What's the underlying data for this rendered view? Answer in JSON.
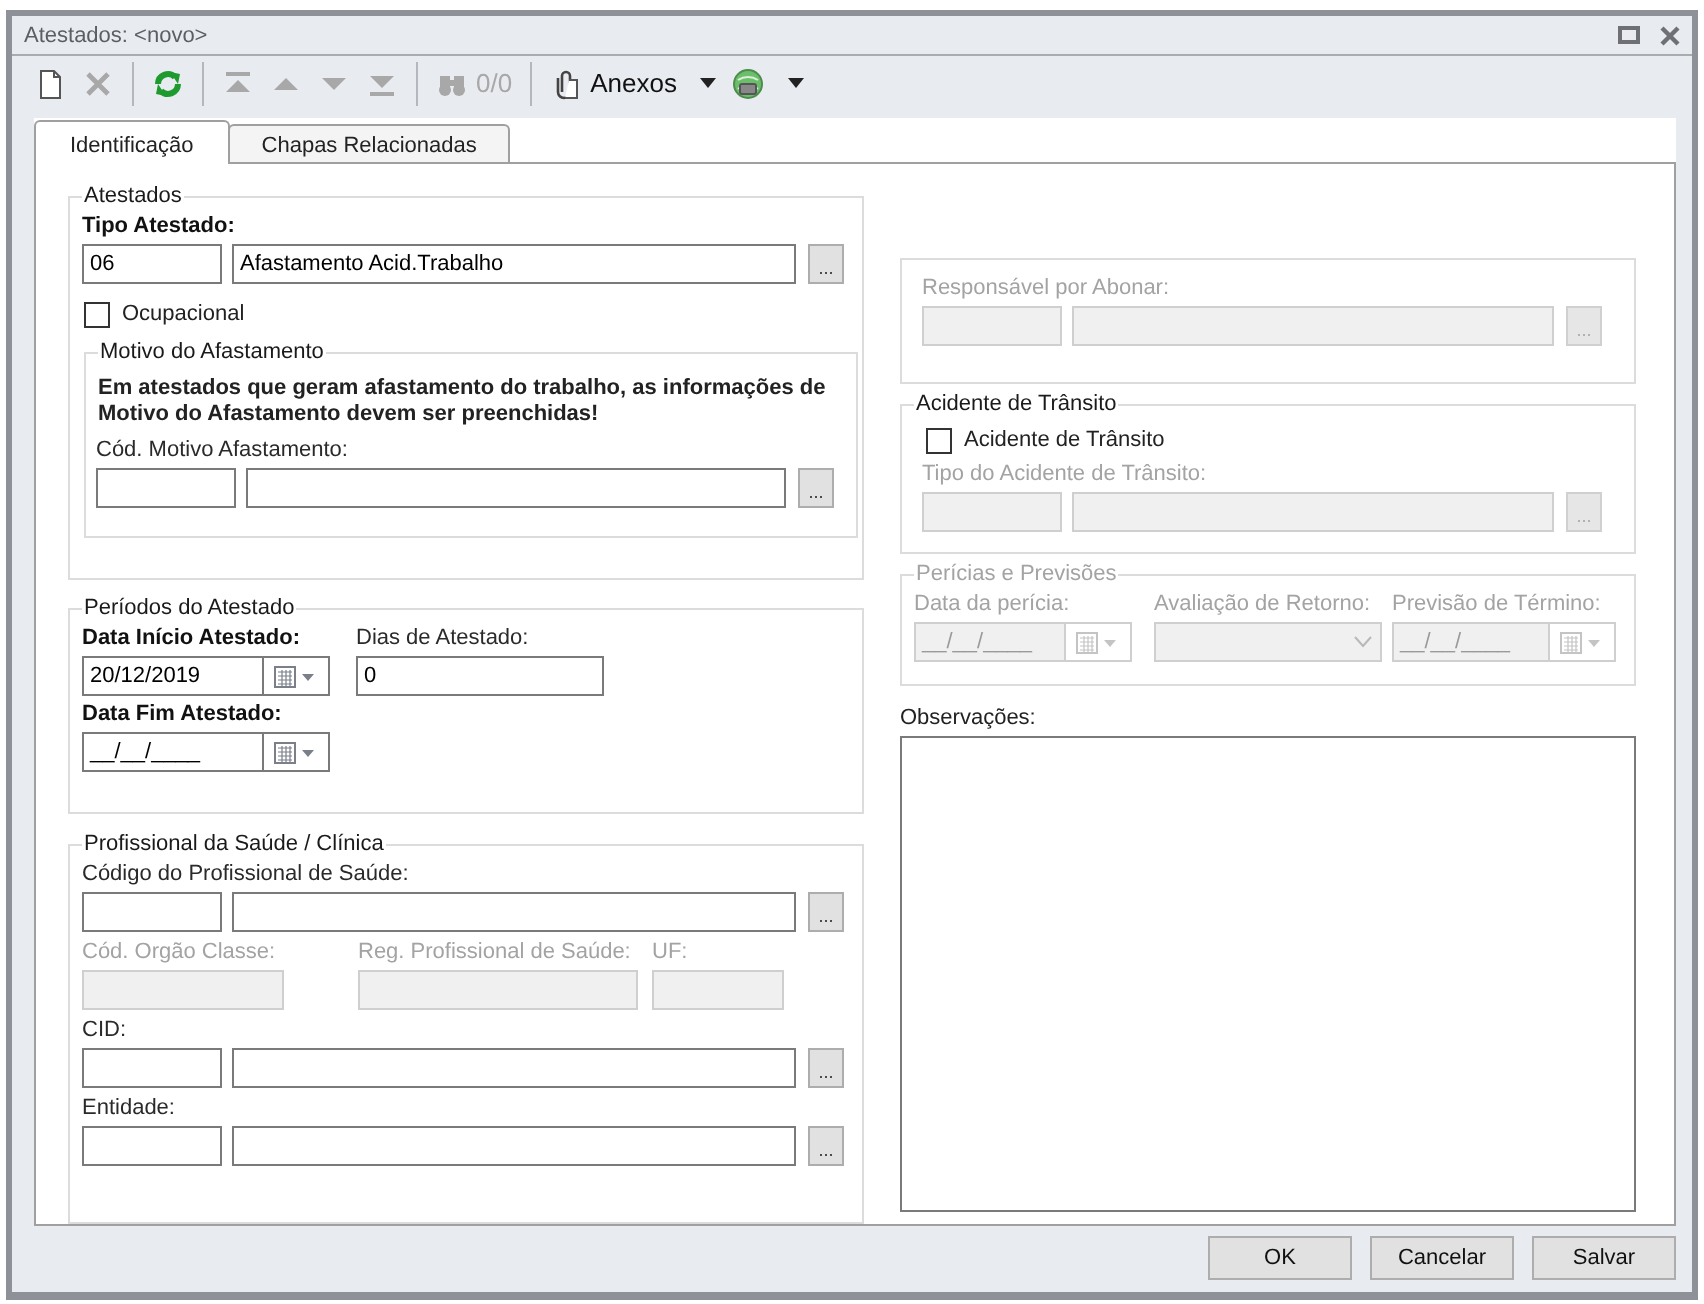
{
  "window": {
    "title": "Atestados: <novo>"
  },
  "toolbar": [
    {
      "kind": "new",
      "disabled": false,
      "separator_before": false,
      "menu": false
    },
    {
      "kind": "delete",
      "disabled": true,
      "separator_before": false,
      "menu": false
    },
    {
      "kind": "refresh",
      "disabled": false,
      "separator_before": true,
      "menu": false
    },
    {
      "kind": "first",
      "disabled": true,
      "separator_before": true,
      "menu": false
    },
    {
      "kind": "previous",
      "disabled": true,
      "separator_before": false,
      "menu": false
    },
    {
      "kind": "next",
      "disabled": true,
      "separator_before": false,
      "menu": false
    },
    {
      "kind": "last",
      "disabled": true,
      "separator_before": false,
      "menu": false
    },
    {
      "kind": "find",
      "disabled": true,
      "separator_before": true,
      "menu": false,
      "label": "0/0"
    },
    {
      "kind": "attachments",
      "disabled": false,
      "separator_before": true,
      "menu": true,
      "label": "Anexos"
    },
    {
      "kind": "globe",
      "disabled": false,
      "separator_before": false,
      "menu": true
    }
  ],
  "tabs": [
    {
      "label": "Identificação",
      "selected": true
    },
    {
      "label": "Chapas Relacionadas",
      "selected": false
    }
  ],
  "atestados": {
    "title": "Atestados",
    "tipo_atestado": {
      "label": "Tipo Atestado:",
      "required": true,
      "code": "06",
      "description": "Afastamento Acid.Trabalho",
      "lookup": "..."
    },
    "ocupacional": {
      "label": "Ocupacional",
      "checked": false
    },
    "motivo_afastamento": {
      "title": "Motivo do Afastamento",
      "message": "Em atestados que geram afastamento do trabalho, as informações de Motivo do Afastamento devem ser preenchidas!",
      "field": {
        "label": "Cód. Motivo Afastamento:",
        "lookup": "..."
      }
    }
  },
  "periodos": {
    "title": "Períodos do Atestado",
    "data_inicio": {
      "label": "Data Início Atestado:",
      "required": true,
      "value": "20/12/2019"
    },
    "dias": {
      "label": "Dias de Atestado:",
      "value": "0"
    },
    "data_fim": {
      "label": "Data Fim Atestado:",
      "required": true,
      "value": "__/__/____"
    }
  },
  "profissional": {
    "title": "Profissional da Saúde / Clínica",
    "codigo": {
      "label": "Código do Profissional de Saúde:",
      "lookup": "..."
    },
    "orgao_classe": {
      "label": "Cód. Orgão Classe:",
      "disabled": true
    },
    "registro": {
      "label": "Reg. Profissional de Saúde:",
      "disabled": true
    },
    "uf": {
      "label": "UF:",
      "disabled": true
    },
    "cid": {
      "label": "CID:",
      "lookup": "..."
    },
    "entidade": {
      "label": "Entidade:",
      "lookup": "..."
    }
  },
  "responsavel": {
    "label": "Responsável por Abonar:",
    "lookup": "...",
    "disabled": true
  },
  "acidente_transito": {
    "title": "Acidente de Trânsito",
    "checkbox": {
      "label": "Acidente de Trânsito",
      "checked": false
    },
    "tipo": {
      "label": "Tipo do Acidente de Trânsito:",
      "lookup": "...",
      "disabled": true
    }
  },
  "pericias": {
    "title": "Perícias e Previsões",
    "disabled": true,
    "data_pericia": {
      "label": "Data da perícia:",
      "value": "__/__/____",
      "disabled": true
    },
    "avaliacao_retorno": {
      "label": "Avaliação de Retorno:",
      "disabled": true
    },
    "previsao_termino": {
      "label": "Previsão de Término:",
      "value": "__/__/____",
      "disabled": true
    }
  },
  "observacoes": {
    "label": "Observações:"
  },
  "buttons": [
    {
      "label": "OK"
    },
    {
      "label": "Cancelar"
    },
    {
      "label": "Salvar"
    }
  ]
}
